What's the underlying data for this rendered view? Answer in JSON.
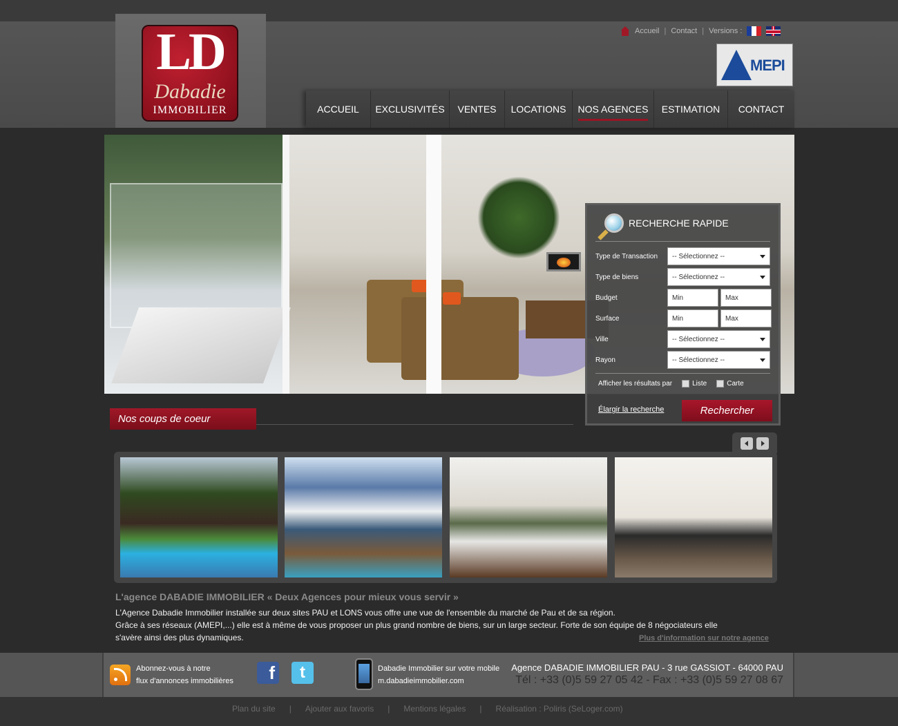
{
  "brand": {
    "logo_letters": "LD",
    "logo_name": "Dabadie",
    "logo_sub": "IMMOBILIER"
  },
  "toplinks": {
    "home_icon": "home-icon",
    "accueil": "Accueil",
    "contact": "Contact",
    "versions": "Versions :",
    "sep": "|"
  },
  "partner": {
    "name": "MEPI"
  },
  "nav": {
    "items": [
      "ACCUEIL",
      "EXCLUSIVITÉS",
      "VENTES",
      "LOCATIONS",
      "NOS AGENCES",
      "ESTIMATION",
      "CONTACT"
    ],
    "active": "NOS AGENCES"
  },
  "search": {
    "title": "RECHERCHE RAPIDE",
    "rows": [
      {
        "label": "Type de Transaction",
        "value": "-- Sélectionnez --"
      },
      {
        "label": "Type de biens",
        "value": "-- Sélectionnez --"
      },
      {
        "label": "Budget",
        "min": "Min",
        "max": "Max"
      },
      {
        "label": "Surface",
        "min": "Min",
        "max": "Max"
      },
      {
        "label": "Ville",
        "value": "-- Sélectionnez --"
      },
      {
        "label": "Rayon",
        "value": "-- Sélectionnez --"
      }
    ],
    "show_label": "Afficher les résultats par",
    "opt_list": "Liste",
    "opt_map": "Carte",
    "broaden": "Élargir la recherche",
    "submit": "Rechercher"
  },
  "featured": {
    "title": "Nos coups de coeur"
  },
  "agency": {
    "title": "L'agence DABADIE IMMOBILIER",
    "subtitle": "« Deux Agences pour mieux vous servir »",
    "line1": "L'Agence Dabadie Immobilier installée sur deux sites PAU et LONS vous offre une vue de l'ensemble du marché de Pau et de sa région.",
    "line2": "Grâce à ses réseaux (AMEPI,...) elle est à même de vous proposer un plus grand nombre de biens, sur un large secteur. Forte de son équipe de 8 négociateurs elle",
    "line3": "s'avère ainsi des plus dynamiques.",
    "more": "Plus d'information sur notre agence"
  },
  "footer": {
    "rss_1": "Abonnez-vous à notre",
    "rss_2": "flux d'annonces immobilières",
    "facebook": "f",
    "twitter": "t",
    "mobile_1": "Dabadie Immobilier sur votre mobile",
    "mobile_2": "m.dabadieimmobilier.com",
    "address": "Agence DABADIE IMMOBILIER PAU - 3 rue GASSIOT - 64000 PAU",
    "phone": "Tél : +33 (0)5 59 27 05 42 - Fax : +33 (0)5 59 27 08 67"
  },
  "bottom_links": [
    "Plan du site",
    "|",
    "Ajouter aux favoris",
    "|",
    "Mentions légales",
    "|",
    "Réalisation : Poliris (SeLoger.com)"
  ],
  "colors": {
    "accent": "#9a1424",
    "background": "#2b2b2b"
  }
}
